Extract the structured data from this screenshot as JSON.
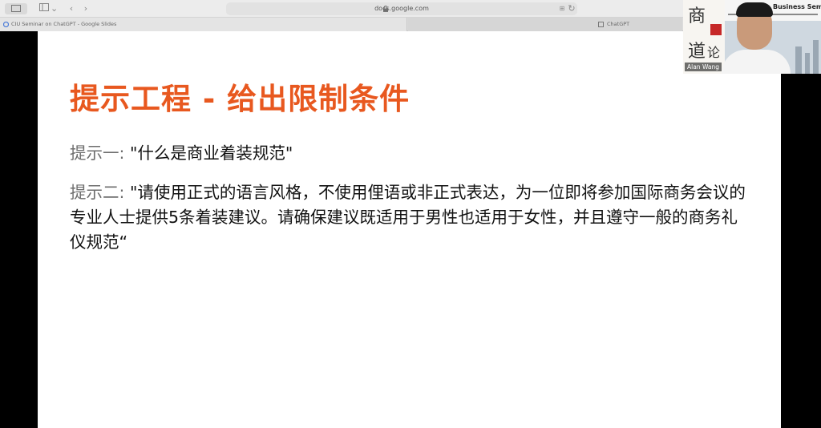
{
  "browser": {
    "url": "docs.google.com",
    "tabs": [
      {
        "label": "CIU Seminar on ChatGPT - Google Slides",
        "icon": "google-icon"
      },
      {
        "label": "ChatGPT",
        "icon": "chatgpt-icon"
      }
    ],
    "toolbar_icons": [
      "sidebar-icon",
      "back-icon",
      "forward-icon",
      "shield-icon",
      "translate-icon",
      "reload-icon"
    ]
  },
  "slide": {
    "title": "提示工程 - 给出限制条件",
    "prompt1_label": "提示一:",
    "prompt1_text": " \"什么是商业着装规范\"",
    "prompt2_label": "提示二:",
    "prompt2_text": " \"请使用正式的语言风格，不使用俚语或非正式表达，为一位即将参加国际商务会议的专业人士提供5条着装建议。请确保建议既适用于男性也适用于女性，并且遵守一般的商务礼仪规范“"
  },
  "video": {
    "participant_name": "Alan Wang",
    "banner_title": "Business Seminar"
  },
  "colors": {
    "title": "#e8581f",
    "label": "#6d6d6d",
    "body": "#111111"
  }
}
